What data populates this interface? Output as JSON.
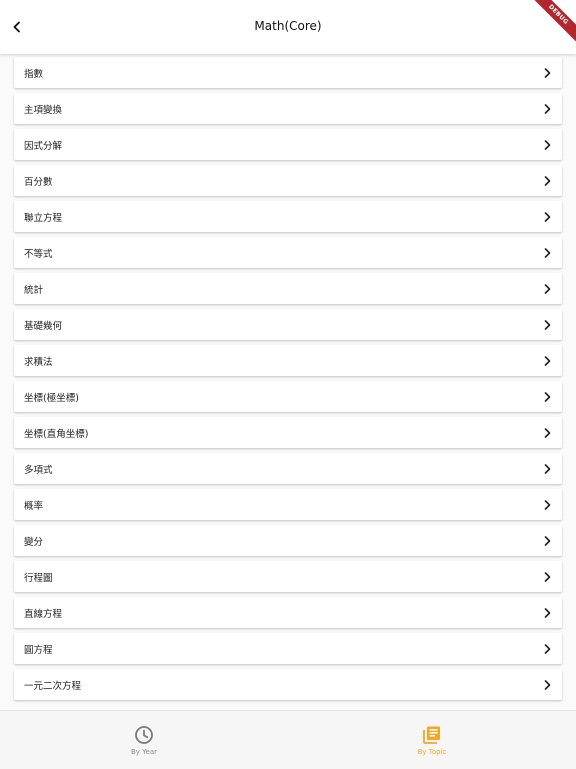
{
  "app_bar": {
    "title": "Math(Core)",
    "back_icon": "chevron-left-icon"
  },
  "debug_banner": {
    "text": "DEBUG",
    "color": "#b3262d"
  },
  "topics": [
    {
      "label": "指數"
    },
    {
      "label": "主項變換"
    },
    {
      "label": "因式分解"
    },
    {
      "label": "百分數"
    },
    {
      "label": "聯立方程"
    },
    {
      "label": "不等式"
    },
    {
      "label": "統計"
    },
    {
      "label": "基礎幾何"
    },
    {
      "label": "求積法"
    },
    {
      "label": "坐標(極坐標)"
    },
    {
      "label": "坐標(直角坐標)"
    },
    {
      "label": "多項式"
    },
    {
      "label": "概率"
    },
    {
      "label": "變分"
    },
    {
      "label": "行程圖"
    },
    {
      "label": "直線方程"
    },
    {
      "label": "圓方程"
    },
    {
      "label": "一元二次方程"
    }
  ],
  "row_icon": "chevron-right-icon",
  "bottom_nav": {
    "items": [
      {
        "label": "By Year",
        "icon": "clock-icon",
        "selected": false
      },
      {
        "label": "By Topic",
        "icon": "library-books-icon",
        "selected": true
      }
    ],
    "active_color": "#f5a623",
    "inactive_color": "#8a8a8a"
  }
}
